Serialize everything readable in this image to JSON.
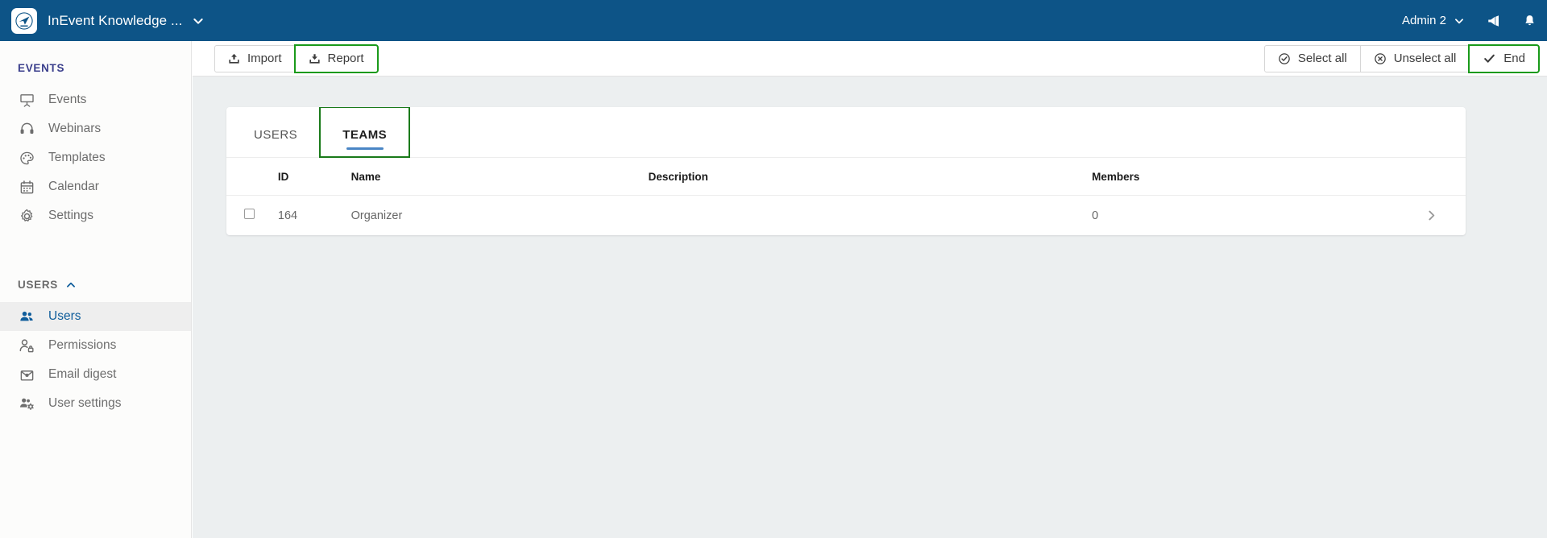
{
  "topbar": {
    "logo_icon": "inevent-logo-icon",
    "title": "InEvent Knowledge ...",
    "brand_caret_icon": "chevron-down-icon",
    "account_label": "Admin 2",
    "account_caret_icon": "chevron-down-icon",
    "announcements_icon": "megaphone-icon",
    "notifications_icon": "bell-icon",
    "background_color": "#0d5487"
  },
  "sidebar": {
    "sections": [
      {
        "title": "EVENTS",
        "title_color": "#3b3f8c",
        "collapse_icon": null,
        "items": [
          {
            "label": "Events",
            "icon": "presentation-screen-icon",
            "active": false
          },
          {
            "label": "Webinars",
            "icon": "headset-icon",
            "active": false
          },
          {
            "label": "Templates",
            "icon": "palette-icon",
            "active": false
          },
          {
            "label": "Calendar",
            "icon": "calendar-icon",
            "active": false
          },
          {
            "label": "Settings",
            "icon": "gear-icon",
            "active": false
          }
        ]
      },
      {
        "title": "USERS",
        "title_color": "#6b6b6b",
        "collapse_icon": "chevron-up-icon",
        "items": [
          {
            "label": "Users",
            "icon": "users-group-icon",
            "active": true
          },
          {
            "label": "Permissions",
            "icon": "user-lock-icon",
            "active": false
          },
          {
            "label": "Email digest",
            "icon": "envelope-icon",
            "active": false
          },
          {
            "label": "User settings",
            "icon": "users-cog-icon",
            "active": false
          }
        ]
      }
    ],
    "active_item_color": "#0f5d9b"
  },
  "toolbar": {
    "left_buttons": [
      {
        "label": "Import",
        "icon": "upload-icon",
        "highlighted": false
      },
      {
        "label": "Report",
        "icon": "download-icon",
        "highlighted": true
      }
    ],
    "right_buttons": [
      {
        "label": "Select all",
        "icon": "circle-check-icon",
        "highlighted": false
      },
      {
        "label": "Unselect all",
        "icon": "circle-x-icon",
        "highlighted": false
      },
      {
        "label": "End",
        "icon": "check-icon",
        "highlighted": true
      }
    ],
    "highlight_color": "#1a9a1a"
  },
  "card": {
    "tabs": [
      {
        "label": "USERS",
        "active": false,
        "highlighted": false
      },
      {
        "label": "TEAMS",
        "active": true,
        "highlighted": true
      }
    ],
    "active_underline_color": "#4a86c5",
    "table": {
      "columns": [
        "",
        "ID",
        "Name",
        "Description",
        "Members",
        ""
      ],
      "rows": [
        {
          "checkbox": false,
          "id": "164",
          "name": "Organizer",
          "description": "",
          "members": "0",
          "arrow_icon": "chevron-right-icon"
        }
      ]
    }
  }
}
